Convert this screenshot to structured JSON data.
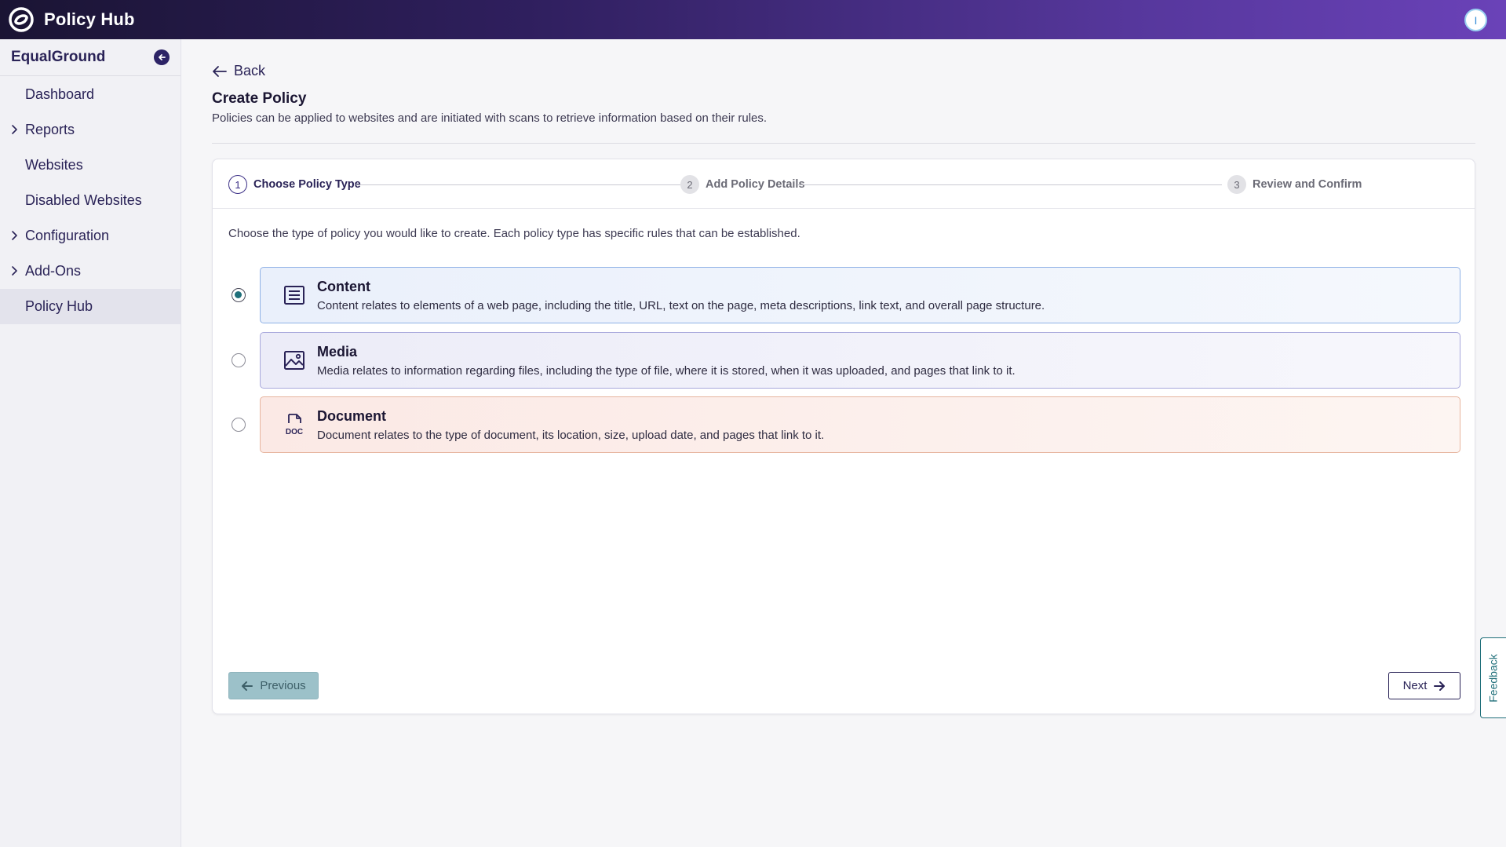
{
  "header": {
    "app_title": "Policy Hub",
    "avatar_initial": "I"
  },
  "sidebar": {
    "org_name": "EqualGround",
    "items": [
      {
        "label": "Dashboard",
        "expandable": false
      },
      {
        "label": "Reports",
        "expandable": true
      },
      {
        "label": "Websites",
        "expandable": false
      },
      {
        "label": "Disabled Websites",
        "expandable": false
      },
      {
        "label": "Configuration",
        "expandable": true
      },
      {
        "label": "Add-Ons",
        "expandable": true
      },
      {
        "label": "Policy Hub",
        "expandable": false,
        "active": true
      }
    ]
  },
  "page": {
    "back_label": "Back",
    "title": "Create Policy",
    "subtitle": "Policies can be applied to websites and are initiated with scans to retrieve information based on their rules."
  },
  "stepper": {
    "steps": [
      {
        "number": "1",
        "label": "Choose Policy Type",
        "state": "current"
      },
      {
        "number": "2",
        "label": "Add Policy Details",
        "state": "future"
      },
      {
        "number": "3",
        "label": "Review and Confirm",
        "state": "future"
      }
    ]
  },
  "intro": "Choose the type of policy you would like to create. Each policy type has specific rules that can be established.",
  "options": [
    {
      "title": "Content",
      "description": "Content relates to elements of a web page, including the title, URL, text on the page, meta descriptions, link text, and overall page structure.",
      "selected": true,
      "icon": "content-icon"
    },
    {
      "title": "Media",
      "description": "Media relates to information regarding files, including the type of file, where it is stored, when it was uploaded, and pages that link to it.",
      "selected": false,
      "icon": "image-icon"
    },
    {
      "title": "Document",
      "description": "Document relates to the type of document, its location, size, upload date, and pages that link to it.",
      "selected": false,
      "icon": "doc-file-icon",
      "icon_text": "DOC"
    }
  ],
  "buttons": {
    "previous": "Previous",
    "next": "Next"
  },
  "feedback_label": "Feedback",
  "colors": {
    "brand_dark": "#1a1433",
    "brand_accent": "#6a42b8",
    "teal": "#1f6f7a",
    "navy": "#2a2357"
  }
}
